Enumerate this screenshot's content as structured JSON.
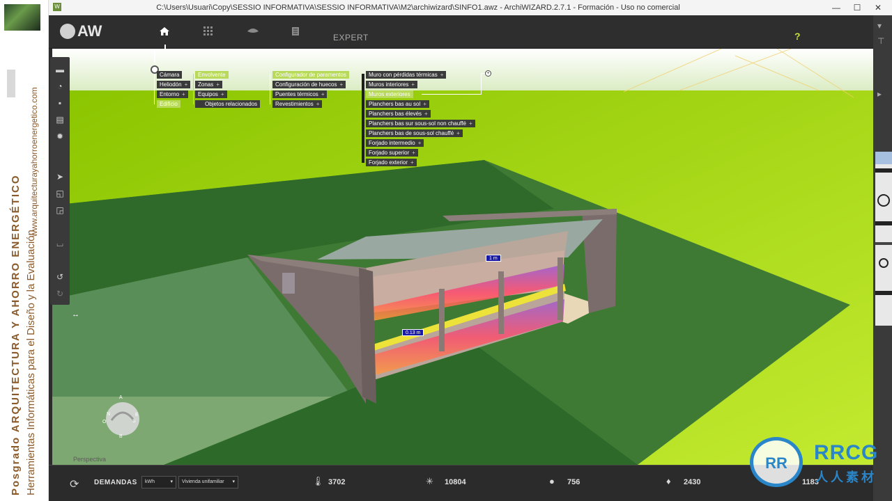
{
  "brand": {
    "vertical_text_1": "Posgrado",
    "vertical_text_2": "ARQUITECTURA Y AHORRO ENERGÉTICO",
    "vertical_text_3": "Herramientas Informáticas para el Diseño y la Evaluación",
    "vertical_text_4": "www.arquitecturayahorroenergetico.com"
  },
  "titlebar": {
    "title": "C:\\Users\\Usuari\\Copy\\SESSIO INFORMATIVA\\SESSIO INFORMATIVA\\M2\\archiwizard\\SINFO1.awz  -  ArchiWIZARD.2.7.1 - Formación - Uso no comercial",
    "minimize": "—",
    "maximize": "☐",
    "close": "✕"
  },
  "toolbar": {
    "logo": "AW",
    "home_icon": "home-icon",
    "grid_icon": "grid-icon",
    "eye_icon": "eye-icon",
    "doc_icon": "document-icon",
    "expert_label": "EXPERT",
    "help_label": "?"
  },
  "tree": {
    "col1": [
      "Cámara",
      "Heliodón",
      "Entorno",
      "Edificio"
    ],
    "col2": [
      "Envolvente",
      "Zonas",
      "Equipos",
      "Objetos relacionados"
    ],
    "col3": [
      "Configurador de paramentos",
      "Configuración de huecos",
      "Puentes térmicos",
      "Revestimientos"
    ],
    "col4": [
      "Muro con pérdidas térmicas",
      "Muros interiores",
      "Muros exteriores",
      "Planchers bas au sol",
      "Planchers bas élevés",
      "Planchers bas sur sous-sol non chauffé",
      "Planchers bas de sous-sol chauffé",
      "Forjado intermedio",
      "Forjado superior",
      "Forjado exterior"
    ],
    "add_symbol": "+"
  },
  "viewport": {
    "measure_1": "1 m",
    "measure_2": "0.13 m",
    "view_mode": "Perspectiva",
    "compass": {
      "n": "A",
      "s": "B",
      "e": "E",
      "w": "O",
      "nn": "N",
      "ss": "S"
    }
  },
  "status": {
    "demandas_label": "DEMANDAS",
    "unit_value": "kWh",
    "building_type": "Vivienda unifamiliar",
    "heating": "3702",
    "cooling": "10804",
    "lighting": "756",
    "water": "2430",
    "total": "1183"
  },
  "watermark": {
    "brand": "RRCG",
    "cn": "人人素材"
  }
}
